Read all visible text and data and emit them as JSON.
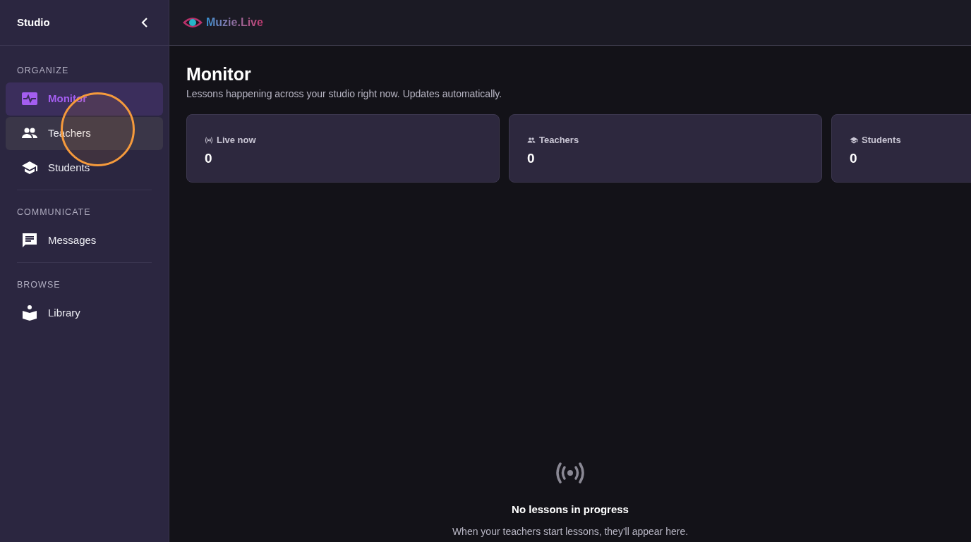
{
  "sidebar": {
    "title": "Studio",
    "sections": [
      {
        "heading": "ORGANIZE",
        "items": [
          {
            "label": "Monitor",
            "selected": true,
            "hovered": false
          },
          {
            "label": "Teachers",
            "selected": false,
            "hovered": true
          },
          {
            "label": "Students",
            "selected": false,
            "hovered": false
          }
        ]
      },
      {
        "heading": "COMMUNICATE",
        "items": [
          {
            "label": "Messages",
            "selected": false,
            "hovered": false
          }
        ]
      },
      {
        "heading": "BROWSE",
        "items": [
          {
            "label": "Library",
            "selected": false,
            "hovered": false
          }
        ]
      }
    ]
  },
  "header": {
    "logo_text": "Muzie.Live"
  },
  "page": {
    "title": "Monitor",
    "subtitle": "Lessons happening across your studio right now. Updates automatically.",
    "stats": [
      {
        "label": "Live now",
        "value": "0"
      },
      {
        "label": "Teachers",
        "value": "0"
      },
      {
        "label": "Students",
        "value": "0"
      }
    ],
    "empty_state": {
      "title": "No lessons in progress",
      "text": "When your teachers start lessons, they'll appear here."
    }
  }
}
